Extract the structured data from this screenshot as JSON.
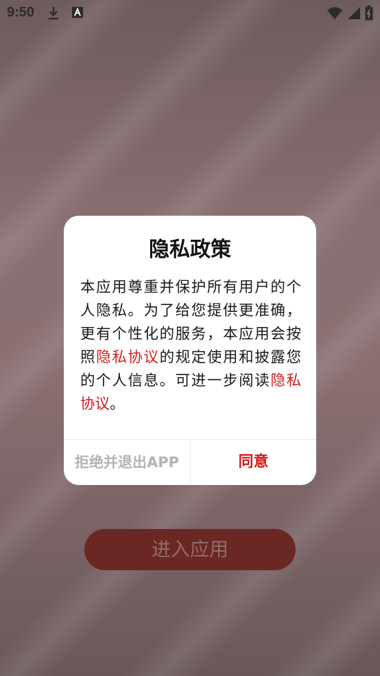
{
  "status_bar": {
    "time": "9:50"
  },
  "enter_button_label": "进入应用",
  "dialog": {
    "title": "隐私政策",
    "body_part1": "本应用尊重并保护所有用户的个人隐私。为了给您提供更准确，更有个性化的服务，本应用会按照",
    "link1": "隐私协议",
    "body_part2": "的规定使用和披露您的个人信息。可进一步阅读",
    "link2": "隐私协议",
    "body_part3": "。",
    "decline_label": "拒绝并退出APP",
    "agree_label": "同意"
  },
  "colors": {
    "accent": "#d31b1b",
    "button_bg": "#6b2723"
  }
}
